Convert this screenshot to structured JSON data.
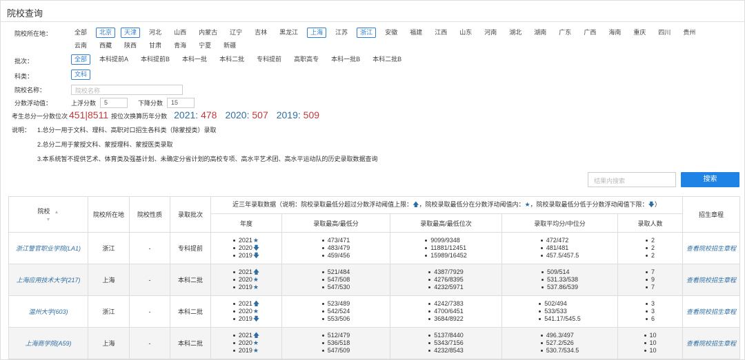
{
  "page_title": "院校查询",
  "filters": {
    "location": {
      "label": "院校所在地：",
      "options": [
        {
          "label": "全部",
          "selected": false
        },
        {
          "label": "北京",
          "selected": true
        },
        {
          "label": "天津",
          "selected": true
        },
        {
          "label": "河北",
          "selected": false
        },
        {
          "label": "山西",
          "selected": false
        },
        {
          "label": "内蒙古",
          "selected": false
        },
        {
          "label": "辽宁",
          "selected": false
        },
        {
          "label": "吉林",
          "selected": false
        },
        {
          "label": "黑龙江",
          "selected": false
        },
        {
          "label": "上海",
          "selected": true
        },
        {
          "label": "江苏",
          "selected": false
        },
        {
          "label": "浙江",
          "selected": true
        },
        {
          "label": "安徽",
          "selected": false
        },
        {
          "label": "福建",
          "selected": false
        },
        {
          "label": "江西",
          "selected": false
        },
        {
          "label": "山东",
          "selected": false
        },
        {
          "label": "河南",
          "selected": false
        },
        {
          "label": "湖北",
          "selected": false
        },
        {
          "label": "湖南",
          "selected": false
        },
        {
          "label": "广东",
          "selected": false
        },
        {
          "label": "广西",
          "selected": false
        },
        {
          "label": "海南",
          "selected": false
        },
        {
          "label": "重庆",
          "selected": false
        },
        {
          "label": "四川",
          "selected": false
        },
        {
          "label": "贵州",
          "selected": false
        },
        {
          "label": "云南",
          "selected": false
        },
        {
          "label": "西藏",
          "selected": false
        },
        {
          "label": "陕西",
          "selected": false
        },
        {
          "label": "甘肃",
          "selected": false
        },
        {
          "label": "青海",
          "selected": false
        },
        {
          "label": "宁夏",
          "selected": false
        },
        {
          "label": "新疆",
          "selected": false
        }
      ]
    },
    "batch": {
      "label": "批次：",
      "options": [
        {
          "label": "全部",
          "selected": true
        },
        {
          "label": "本科提前A",
          "selected": false
        },
        {
          "label": "本科提前B",
          "selected": false
        },
        {
          "label": "本科一批",
          "selected": false
        },
        {
          "label": "本科二批",
          "selected": false
        },
        {
          "label": "专科提前",
          "selected": false
        },
        {
          "label": "高职高专",
          "selected": false
        },
        {
          "label": "本科一批B",
          "selected": false
        },
        {
          "label": "本科二批B",
          "selected": false
        }
      ]
    },
    "subject": {
      "label": "科类：",
      "options": [
        {
          "label": "文科",
          "selected": true
        }
      ]
    },
    "school_name": {
      "label": "院校名称：",
      "placeholder": "院校名称"
    },
    "score_float": {
      "label": "分数浮动值：",
      "up_label": "上浮分数",
      "up_value": "5",
      "down_label": "下降分数",
      "down_value": "15"
    }
  },
  "score_info": {
    "label": "考生总分一分数位次",
    "score_rank": "451|8511",
    "convert_label": "按位次换算历年分数",
    "y2021": "2021: ",
    "v2021": "478",
    "y2020": "2020: ",
    "v2020": "507",
    "y2019": "2019: ",
    "v2019": "509"
  },
  "notes": {
    "label": "说明：",
    "line1": "1.总分一用于文科、理科、高职对口招生各科类（除蒙授类）录取",
    "line2": "2.总分二用于蒙授文科、蒙授理科、蒙授医类录取",
    "line3": "3.本系统暂不提供艺术、体育类及强基计划、未确定分省计划的高校专项、高水平艺术团、高水平运动队的历史录取数据查询"
  },
  "search": {
    "placeholder": "结果内搜索",
    "button": "搜索"
  },
  "table": {
    "headers": {
      "school": "院校",
      "location": "院校所在地",
      "nature": "院校性质",
      "batch": "录取批次",
      "group": "近三年录取数据（说明：院校录取最低分超过分数浮动阈值上限：",
      "group_mid1": "，院校录取最低分在分数浮动阈值内：",
      "group_mid2": "，院校录取最低分低于分数浮动阈值下限：",
      "group_end": "）",
      "charter": "招生章程",
      "year": "年度",
      "max_min_score": "录取最高/最低分",
      "max_min_rank": "录取最高/最低位次",
      "avg_median": "录取平均分/中位分",
      "count": "录取人数"
    },
    "rows": [
      {
        "school": "浙江警官职业学院(LA1)",
        "location": "浙江",
        "nature": "-",
        "batch": "专科提前",
        "years": [
          {
            "year": "2021",
            "mark": "★"
          },
          {
            "year": "2020",
            "mark": "↓"
          },
          {
            "year": "2019",
            "mark": "↓"
          }
        ],
        "scores": [
          "473/471",
          "483/479",
          "459/456"
        ],
        "ranks": [
          "9099/9348",
          "11881/12451",
          "15989/16452"
        ],
        "avgs": [
          "472/472",
          "481/481",
          "457.5/457.5"
        ],
        "counts": [
          "2",
          "2",
          "2"
        ],
        "charter": "查看院校招生章程"
      },
      {
        "school": "上海应用技术大学(217)",
        "location": "上海",
        "nature": "-",
        "batch": "本科二批",
        "years": [
          {
            "year": "2021",
            "mark": "↑"
          },
          {
            "year": "2020",
            "mark": "★"
          },
          {
            "year": "2019",
            "mark": "★"
          }
        ],
        "scores": [
          "521/484",
          "547/508",
          "547/530"
        ],
        "ranks": [
          "4387/7929",
          "4276/8395",
          "4232/5971"
        ],
        "avgs": [
          "509/514",
          "531.33/538",
          "537.86/539"
        ],
        "counts": [
          "7",
          "9",
          "7"
        ],
        "charter": "查看院校招生章程"
      },
      {
        "school": "温州大学(603)",
        "location": "浙江",
        "nature": "-",
        "batch": "本科二批",
        "years": [
          {
            "year": "2021",
            "mark": "↑"
          },
          {
            "year": "2020",
            "mark": "★"
          },
          {
            "year": "2019",
            "mark": "↓"
          }
        ],
        "scores": [
          "523/489",
          "542/524",
          "553/506"
        ],
        "ranks": [
          "4242/7383",
          "4700/6451",
          "3684/8922"
        ],
        "avgs": [
          "502/494",
          "533/533",
          "541.17/545.5"
        ],
        "counts": [
          "3",
          "3",
          "6"
        ],
        "charter": "查看院校招生章程"
      },
      {
        "school": "上海商学院(A59)",
        "location": "上海",
        "nature": "-",
        "batch": "本科二批",
        "years": [
          {
            "year": "2021",
            "mark": "↑"
          },
          {
            "year": "2020",
            "mark": "★"
          },
          {
            "year": "2019",
            "mark": "★"
          }
        ],
        "scores": [
          "512/479",
          "536/518",
          "547/509"
        ],
        "ranks": [
          "5137/8440",
          "5343/7156",
          "4232/8543"
        ],
        "avgs": [
          "496.3/497",
          "527.2/526",
          "530.7/534.5"
        ],
        "counts": [
          "10",
          "10",
          "10"
        ],
        "charter": "查看院校招生章程"
      }
    ]
  }
}
